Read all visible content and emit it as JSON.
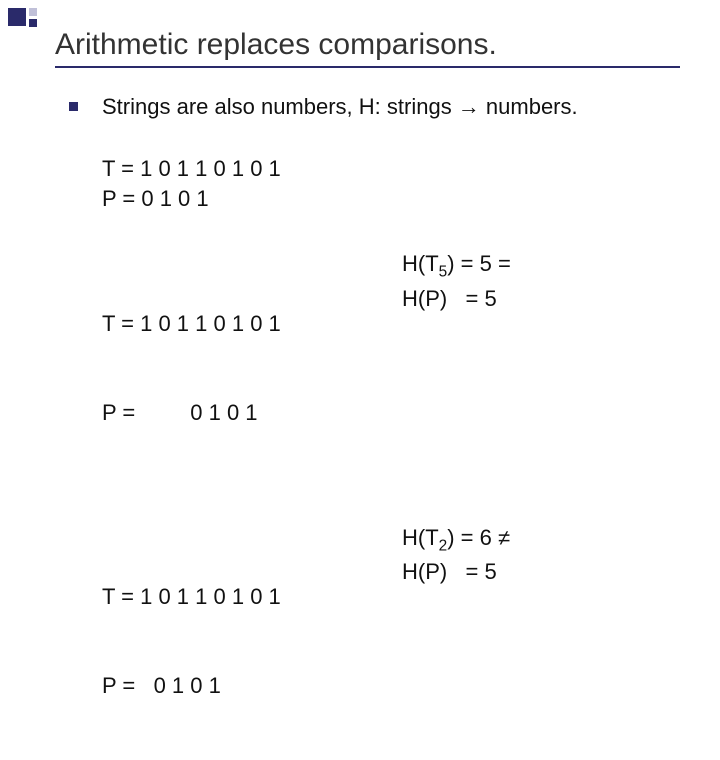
{
  "title": "Arithmetic replaces comparisons.",
  "bullet1": "Strings are also numbers, H: strings → numbers.",
  "block1_l1": "T = 1 0 1 1 0 1 0 1",
  "block1_l2": "P = 0 1 0 1",
  "block2_l1": "T = 1 0 1 1 0 1 0 1",
  "block2_l2": "P =         0 1 0 1",
  "block2_r1a": "H(T",
  "block2_r1sub": "5",
  "block2_r1b": ") = 5 =",
  "block2_r2": "H(P)   = 5",
  "block3_l1": "T = 1 0 1 1 0 1 0 1",
  "block3_l2": "P =   0 1 0 1",
  "block3_r1a": "H(T",
  "block3_r1sub": "2",
  "block3_r1b": ") = 6 ≠",
  "block3_r2": "H(P)   = 5"
}
